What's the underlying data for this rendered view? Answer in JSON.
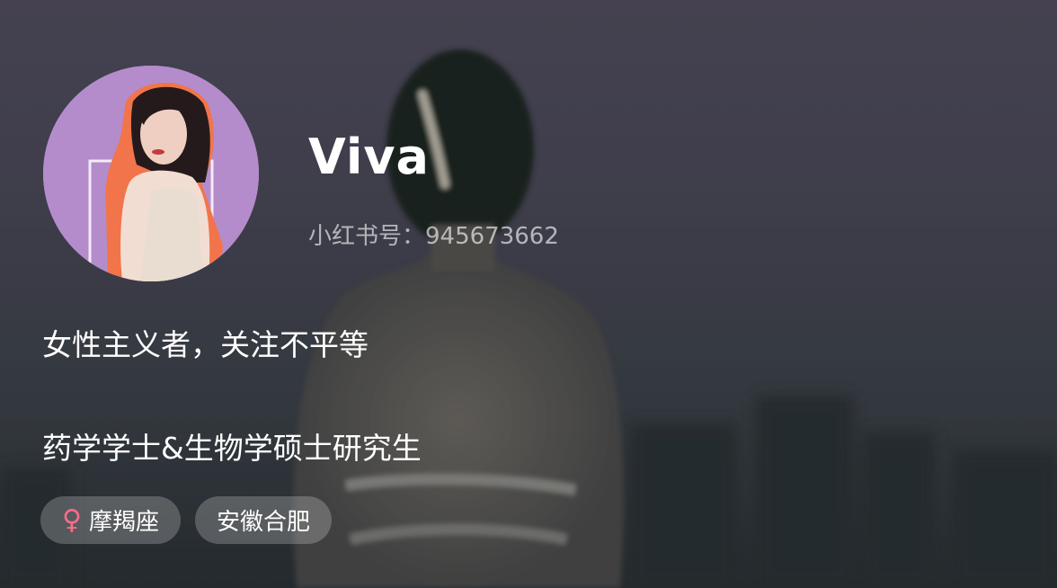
{
  "profile": {
    "nickname": "Viva",
    "red_id": "小红书号：945673662"
  },
  "bio": {
    "line1": "女性主义者，关注不平等",
    "line2": "药学学士&生物学硕士研究生"
  },
  "tags": [
    {
      "icon": "female-icon",
      "icon_glyph": "♀",
      "icon_color": "#ff6b8a",
      "label": "摩羯座"
    },
    {
      "label": "安徽合肥"
    }
  ],
  "colors": {
    "avatar_bg": "#b48ccb",
    "avatar_accent": "#f2744a"
  }
}
